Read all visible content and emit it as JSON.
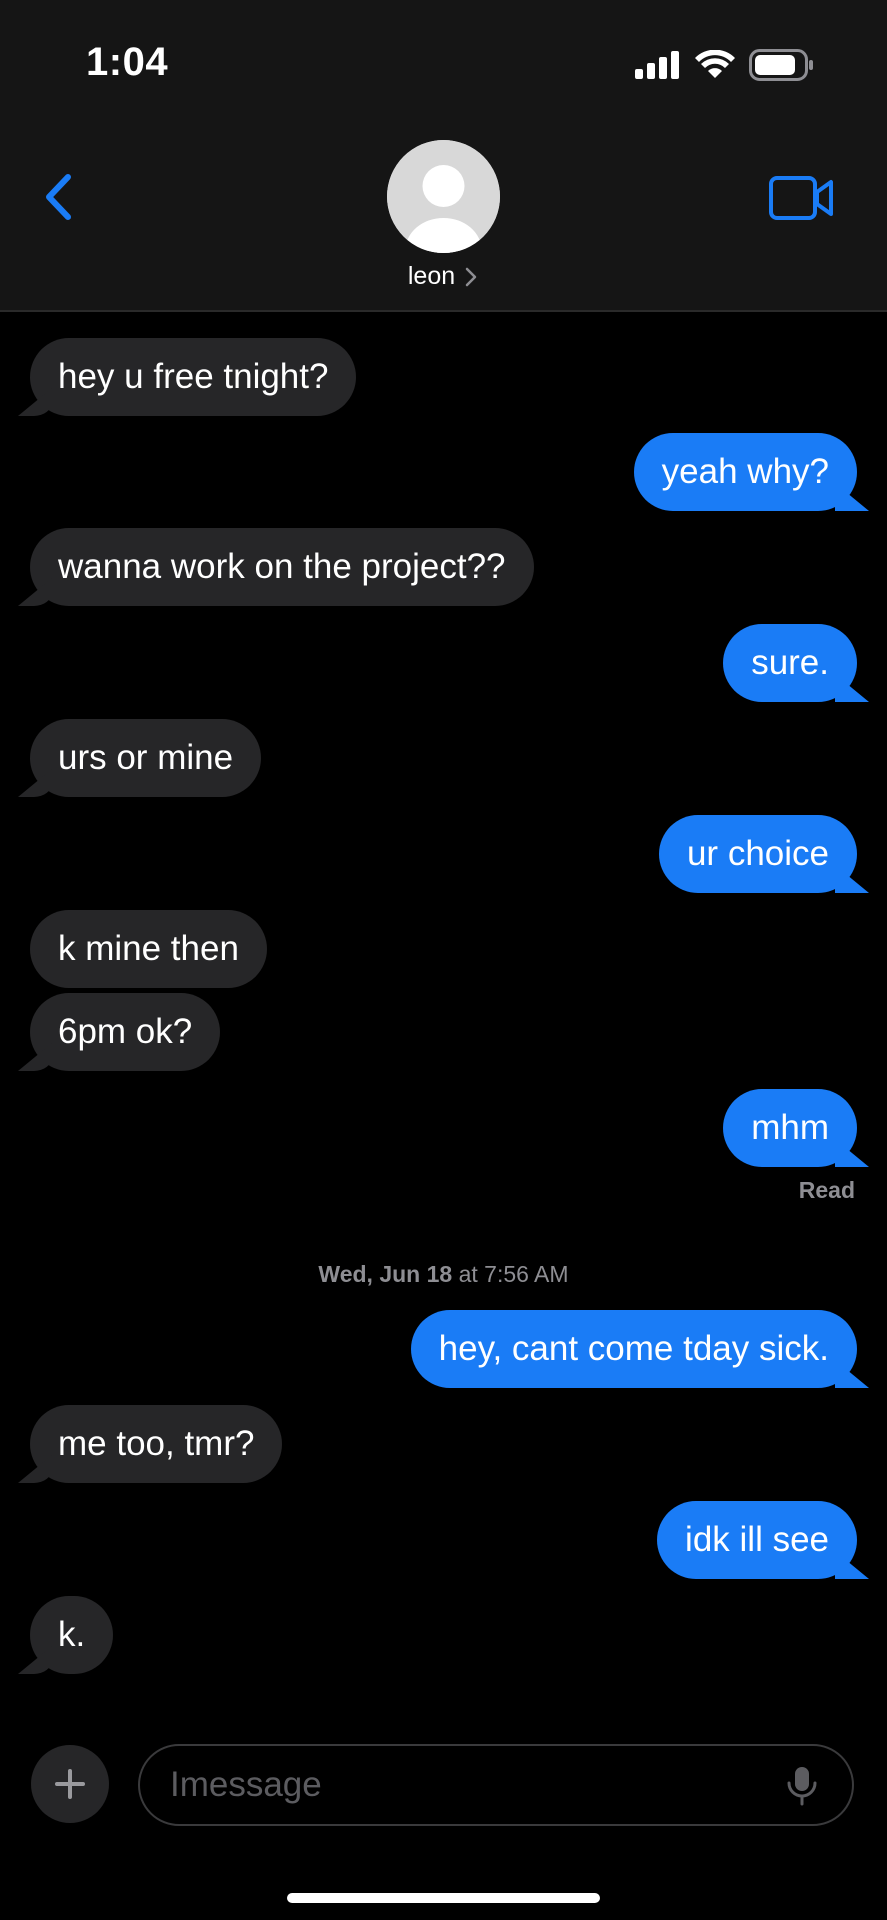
{
  "status_bar": {
    "time": "1:04"
  },
  "header": {
    "contact_name": "leon",
    "back_icon": "chevron-left-icon",
    "video_icon": "video-camera-icon"
  },
  "messages": [
    {
      "direction": "in",
      "text": "hey u free tnight?"
    },
    {
      "direction": "out",
      "text": "yeah why?"
    },
    {
      "direction": "in",
      "text": "wanna work on the project??"
    },
    {
      "direction": "out",
      "text": "sure."
    },
    {
      "direction": "in",
      "text": "urs or mine"
    },
    {
      "direction": "out",
      "text": "ur choice"
    },
    {
      "direction": "in",
      "text": "k mine then"
    },
    {
      "direction": "in",
      "text": "6pm ok?"
    },
    {
      "direction": "out",
      "text": "mhm"
    },
    {
      "direction": "out",
      "text": "hey, cant come tday sick."
    },
    {
      "direction": "in",
      "text": "me too, tmr?"
    },
    {
      "direction": "out",
      "text": "idk ill see"
    },
    {
      "direction": "in",
      "text": "k."
    }
  ],
  "read_receipt": "Read",
  "timestamp": {
    "day": "Wed, Jun 18",
    "time_prefix": " at ",
    "time": "7:56 AM"
  },
  "composer": {
    "placeholder": "Imessage"
  },
  "colors": {
    "incoming_bubble": "#262628",
    "outgoing_bubble": "#1a7cf6",
    "accent": "#1a7cf6",
    "secondary_text": "#8e8e93"
  }
}
